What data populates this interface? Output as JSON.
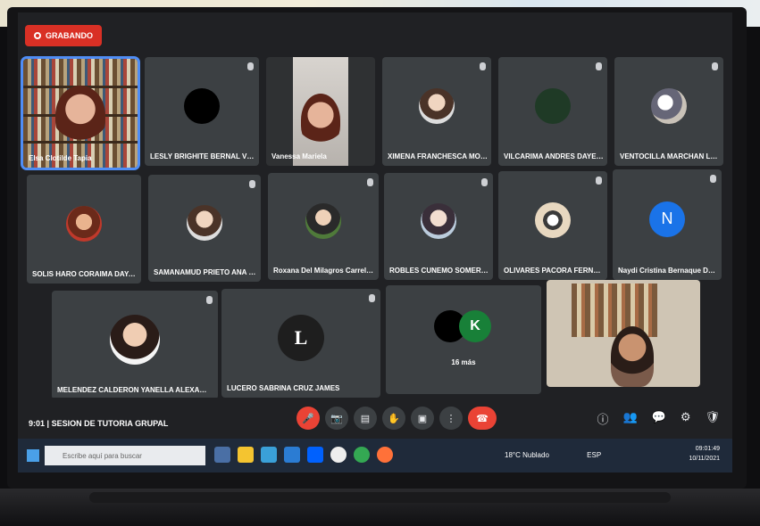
{
  "recording_label": "GRABANDO",
  "meeting": {
    "time": "9:01",
    "separator": "|",
    "title": "SESION DE TUTORIA GRUPAL"
  },
  "participants": [
    {
      "name": "Elsa Clotilde Tapia"
    },
    {
      "name": "LESLY BRIGHITE BERNAL VERA..."
    },
    {
      "name": "Vanessa Mariela"
    },
    {
      "name": "XIMENA FRANCHESCA MORY ..."
    },
    {
      "name": "VILCARIMA ANDRES DAYELI D..."
    },
    {
      "name": "VENTOCILLA MARCHAN LEYS..."
    },
    {
      "name": "SOLIS HARO CORAIMA DAYAN..."
    },
    {
      "name": "SAMANAMUD PRIETO ANA MI..."
    },
    {
      "name": "Roxana Del Milagros Carrello P..."
    },
    {
      "name": "ROBLES CUNEMO SOMER CAR..."
    },
    {
      "name": "OLIVARES PACORA FERNAND..."
    },
    {
      "name": "Naydi Cristina Bernaque Dueñ..."
    },
    {
      "name": "MELENDEZ CALDERON YANELLA ALEXANDRA"
    },
    {
      "name": "LUCERO SABRINA CRUZ JAMES"
    },
    {
      "name": "16 más"
    }
  ],
  "avatars": {
    "n_letter": "N",
    "l_letter": "L",
    "k_letter": "K"
  },
  "taskbar": {
    "search_placeholder": "Escribe aquí para buscar",
    "weather": "18°C Nublado",
    "lang": "ESP",
    "clock_time": "09:01:49",
    "clock_date": "10/11/2021"
  }
}
